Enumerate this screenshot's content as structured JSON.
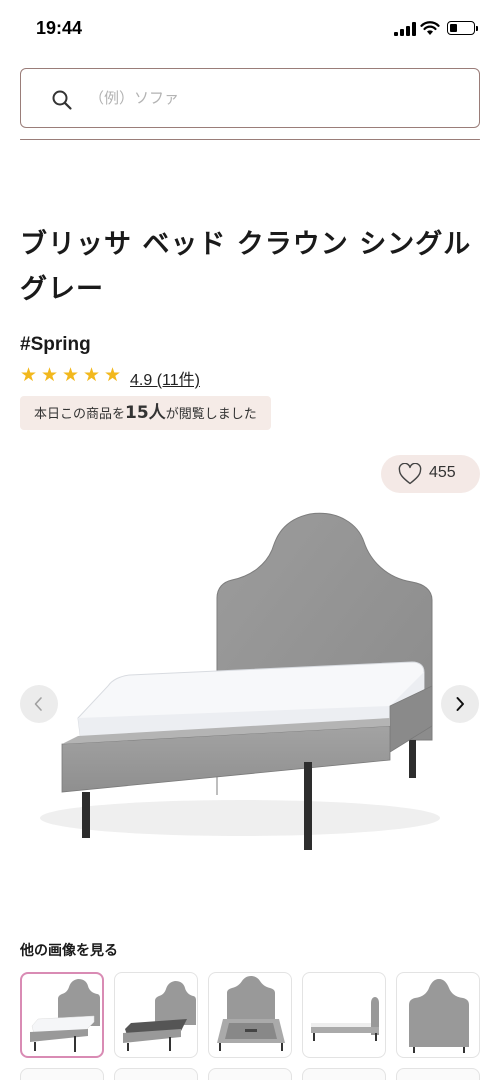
{
  "status_bar": {
    "time": "19:44"
  },
  "search": {
    "placeholder": "（例）ソファ"
  },
  "product": {
    "title": "ブリッサ ベッド クラウン シングル グレー",
    "brand_tag": "#Spring",
    "rating": {
      "stars": 5,
      "label": "4.9 (11件)"
    },
    "views": {
      "prefix": "本日この商品を",
      "count": "15人",
      "suffix": "が閲覧しました"
    },
    "favorite_count": "455"
  },
  "gallery": {
    "heading": "他の画像を見る",
    "thumbnails": [
      "front-view",
      "frame-dark-view",
      "frame-top-view",
      "side-view",
      "headboard-view"
    ]
  },
  "colors": {
    "accent_border": "#9a7d79",
    "badge_bg": "#f5ebe7",
    "star": "#f2b81d",
    "active_thumb": "#d98bb4"
  }
}
